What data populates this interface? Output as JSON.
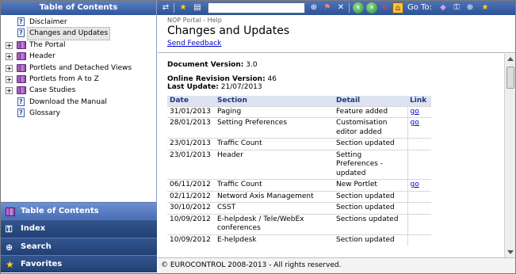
{
  "sidebar": {
    "title": "Table of Contents",
    "tree": [
      {
        "label": "Disclaimer",
        "type": "page",
        "expandable": false,
        "selected": false
      },
      {
        "label": "Changes and Updates",
        "type": "page",
        "expandable": false,
        "selected": true
      },
      {
        "label": "The Portal",
        "type": "book",
        "expandable": true,
        "selected": false
      },
      {
        "label": "Header",
        "type": "book",
        "expandable": true,
        "selected": false
      },
      {
        "label": "Portlets and Detached Views",
        "type": "book",
        "expandable": true,
        "selected": false
      },
      {
        "label": "Portlets from A to Z",
        "type": "book",
        "expandable": true,
        "selected": false
      },
      {
        "label": "Case Studies",
        "type": "book",
        "expandable": true,
        "selected": false
      },
      {
        "label": "Download the Manual",
        "type": "page",
        "expandable": false,
        "selected": false
      },
      {
        "label": "Glossary",
        "type": "page",
        "expandable": false,
        "selected": false
      }
    ],
    "nav_tabs": [
      {
        "label": "Table of Contents",
        "icon": "book-icon",
        "active": true
      },
      {
        "label": "Index",
        "icon": "key-icon",
        "active": false
      },
      {
        "label": "Search",
        "icon": "binoculars-icon",
        "active": false
      },
      {
        "label": "Favorites",
        "icon": "star-icon",
        "active": false
      }
    ]
  },
  "toolbar": {
    "goto_label": "Go To:",
    "search_value": ""
  },
  "content": {
    "breadcrumb": "NOP Portal - Help",
    "title": "Changes and Updates",
    "feedback_link": "Send Feedback",
    "doc_version_label": "Document Version:",
    "doc_version": "3.0",
    "online_rev_label": "Online Revision Version:",
    "online_rev": "46",
    "last_update_label": "Last Update:",
    "last_update": "21/07/2013",
    "table": {
      "headers": [
        "Date",
        "Section",
        "Detail",
        "Link"
      ],
      "rows": [
        {
          "date": "31/01/2013",
          "section": "Paging",
          "detail": "Feature added",
          "link": "go"
        },
        {
          "date": "28/01/2013",
          "section": "Setting Preferences",
          "detail": "Customisation editor added",
          "link": "go"
        },
        {
          "date": "23/01/2013",
          "section": "Traffic Count",
          "detail": "Section updated",
          "link": ""
        },
        {
          "date": "23/01/2013",
          "section": "Header",
          "detail": "Setting Preferences - updated",
          "link": ""
        },
        {
          "date": "06/11/2012",
          "section": "Traffic Count",
          "detail": "New Portlet",
          "link": "go"
        },
        {
          "date": "02/11/2012",
          "section": "Netword Axis Management",
          "detail": "Section updated",
          "link": ""
        },
        {
          "date": "30/10/2012",
          "section": "CSST",
          "detail": "Section updated",
          "link": ""
        },
        {
          "date": "10/09/2012",
          "section": "E-helpdesk / Tele/WebEx conferences",
          "detail": "Sections updated",
          "link": ""
        },
        {
          "date": "10/09/2012",
          "section": "E-helpdesk",
          "detail": "Section updated",
          "link": ""
        }
      ]
    }
  },
  "footer": {
    "text": "© EUROCONTROL 2008-2013 - All rights reserved."
  },
  "colors": {
    "header_blue": "#2f569e",
    "active_tab": "#5b7fc0",
    "link": "#0000cc"
  }
}
